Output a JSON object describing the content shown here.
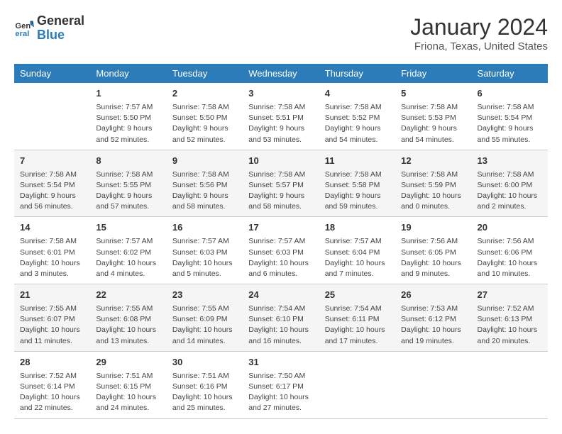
{
  "logo": {
    "line1": "General",
    "line2": "Blue"
  },
  "title": "January 2024",
  "subtitle": "Friona, Texas, United States",
  "days_of_week": [
    "Sunday",
    "Monday",
    "Tuesday",
    "Wednesday",
    "Thursday",
    "Friday",
    "Saturday"
  ],
  "weeks": [
    [
      {
        "day": "",
        "info": ""
      },
      {
        "day": "1",
        "info": "Sunrise: 7:57 AM\nSunset: 5:50 PM\nDaylight: 9 hours and 52 minutes."
      },
      {
        "day": "2",
        "info": "Sunrise: 7:58 AM\nSunset: 5:50 PM\nDaylight: 9 hours and 52 minutes."
      },
      {
        "day": "3",
        "info": "Sunrise: 7:58 AM\nSunset: 5:51 PM\nDaylight: 9 hours and 53 minutes."
      },
      {
        "day": "4",
        "info": "Sunrise: 7:58 AM\nSunset: 5:52 PM\nDaylight: 9 hours and 54 minutes."
      },
      {
        "day": "5",
        "info": "Sunrise: 7:58 AM\nSunset: 5:53 PM\nDaylight: 9 hours and 54 minutes."
      },
      {
        "day": "6",
        "info": "Sunrise: 7:58 AM\nSunset: 5:54 PM\nDaylight: 9 hours and 55 minutes."
      }
    ],
    [
      {
        "day": "7",
        "info": "Sunrise: 7:58 AM\nSunset: 5:54 PM\nDaylight: 9 hours and 56 minutes."
      },
      {
        "day": "8",
        "info": "Sunrise: 7:58 AM\nSunset: 5:55 PM\nDaylight: 9 hours and 57 minutes."
      },
      {
        "day": "9",
        "info": "Sunrise: 7:58 AM\nSunset: 5:56 PM\nDaylight: 9 hours and 58 minutes."
      },
      {
        "day": "10",
        "info": "Sunrise: 7:58 AM\nSunset: 5:57 PM\nDaylight: 9 hours and 58 minutes."
      },
      {
        "day": "11",
        "info": "Sunrise: 7:58 AM\nSunset: 5:58 PM\nDaylight: 9 hours and 59 minutes."
      },
      {
        "day": "12",
        "info": "Sunrise: 7:58 AM\nSunset: 5:59 PM\nDaylight: 10 hours and 0 minutes."
      },
      {
        "day": "13",
        "info": "Sunrise: 7:58 AM\nSunset: 6:00 PM\nDaylight: 10 hours and 2 minutes."
      }
    ],
    [
      {
        "day": "14",
        "info": "Sunrise: 7:58 AM\nSunset: 6:01 PM\nDaylight: 10 hours and 3 minutes."
      },
      {
        "day": "15",
        "info": "Sunrise: 7:57 AM\nSunset: 6:02 PM\nDaylight: 10 hours and 4 minutes."
      },
      {
        "day": "16",
        "info": "Sunrise: 7:57 AM\nSunset: 6:03 PM\nDaylight: 10 hours and 5 minutes."
      },
      {
        "day": "17",
        "info": "Sunrise: 7:57 AM\nSunset: 6:03 PM\nDaylight: 10 hours and 6 minutes."
      },
      {
        "day": "18",
        "info": "Sunrise: 7:57 AM\nSunset: 6:04 PM\nDaylight: 10 hours and 7 minutes."
      },
      {
        "day": "19",
        "info": "Sunrise: 7:56 AM\nSunset: 6:05 PM\nDaylight: 10 hours and 9 minutes."
      },
      {
        "day": "20",
        "info": "Sunrise: 7:56 AM\nSunset: 6:06 PM\nDaylight: 10 hours and 10 minutes."
      }
    ],
    [
      {
        "day": "21",
        "info": "Sunrise: 7:55 AM\nSunset: 6:07 PM\nDaylight: 10 hours and 11 minutes."
      },
      {
        "day": "22",
        "info": "Sunrise: 7:55 AM\nSunset: 6:08 PM\nDaylight: 10 hours and 13 minutes."
      },
      {
        "day": "23",
        "info": "Sunrise: 7:55 AM\nSunset: 6:09 PM\nDaylight: 10 hours and 14 minutes."
      },
      {
        "day": "24",
        "info": "Sunrise: 7:54 AM\nSunset: 6:10 PM\nDaylight: 10 hours and 16 minutes."
      },
      {
        "day": "25",
        "info": "Sunrise: 7:54 AM\nSunset: 6:11 PM\nDaylight: 10 hours and 17 minutes."
      },
      {
        "day": "26",
        "info": "Sunrise: 7:53 AM\nSunset: 6:12 PM\nDaylight: 10 hours and 19 minutes."
      },
      {
        "day": "27",
        "info": "Sunrise: 7:52 AM\nSunset: 6:13 PM\nDaylight: 10 hours and 20 minutes."
      }
    ],
    [
      {
        "day": "28",
        "info": "Sunrise: 7:52 AM\nSunset: 6:14 PM\nDaylight: 10 hours and 22 minutes."
      },
      {
        "day": "29",
        "info": "Sunrise: 7:51 AM\nSunset: 6:15 PM\nDaylight: 10 hours and 24 minutes."
      },
      {
        "day": "30",
        "info": "Sunrise: 7:51 AM\nSunset: 6:16 PM\nDaylight: 10 hours and 25 minutes."
      },
      {
        "day": "31",
        "info": "Sunrise: 7:50 AM\nSunset: 6:17 PM\nDaylight: 10 hours and 27 minutes."
      },
      {
        "day": "",
        "info": ""
      },
      {
        "day": "",
        "info": ""
      },
      {
        "day": "",
        "info": ""
      }
    ]
  ]
}
